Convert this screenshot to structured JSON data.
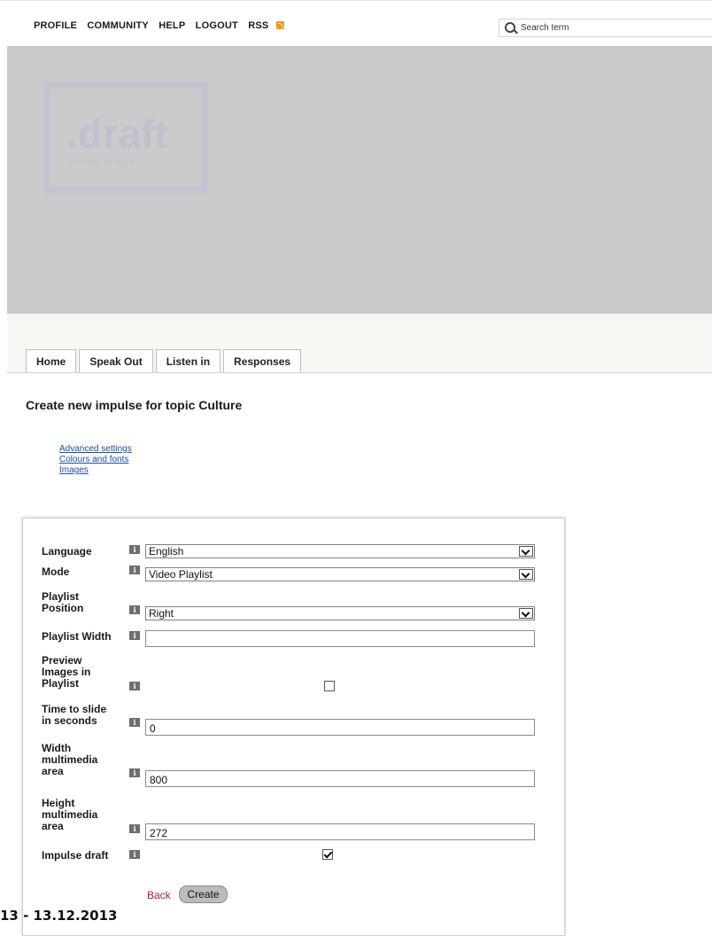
{
  "topnav": {
    "links": [
      "PROFILE",
      "COMMUNITY",
      "HELP",
      "LOGOUT"
    ],
    "rss_label": "RSS",
    "search_placeholder": "Search term"
  },
  "banner": {
    "logo_big": ".draft",
    "logo_small": "Inactive feature"
  },
  "tabs": [
    "Home",
    "Speak Out",
    "Listen in",
    "Responses"
  ],
  "page_title": "Create new impulse for topic Culture",
  "settings_links": [
    "Advanced settings",
    "Colours and fonts",
    "Images"
  ],
  "form": {
    "language": {
      "label": "Language",
      "value": "English"
    },
    "mode": {
      "label": "Mode",
      "value": "Video Playlist"
    },
    "playlist_position": {
      "label_1": "Playlist",
      "label_2": "Position",
      "value": "Right"
    },
    "playlist_width": {
      "label": "Playlist Width",
      "value": ""
    },
    "preview_images": {
      "label_1": "Preview",
      "label_2": "Images in",
      "label_3": "Playlist",
      "checked": false
    },
    "time_to_slide": {
      "label_1": "Time to slide",
      "label_2": "in seconds",
      "value": "0"
    },
    "width_area": {
      "label_1": "Width",
      "label_2": "multimedia",
      "label_3": "area",
      "value": "800"
    },
    "height_area": {
      "label_1": "Height",
      "label_2": "multimedia",
      "label_3": "area",
      "value": "272"
    },
    "impulse_draft": {
      "label": "Impulse draft",
      "checked": true
    },
    "info_icon_glyph": "i",
    "back_label": "Back",
    "create_label": "Create"
  },
  "footer": {
    "date_text": "13 - 13.12.2013"
  }
}
